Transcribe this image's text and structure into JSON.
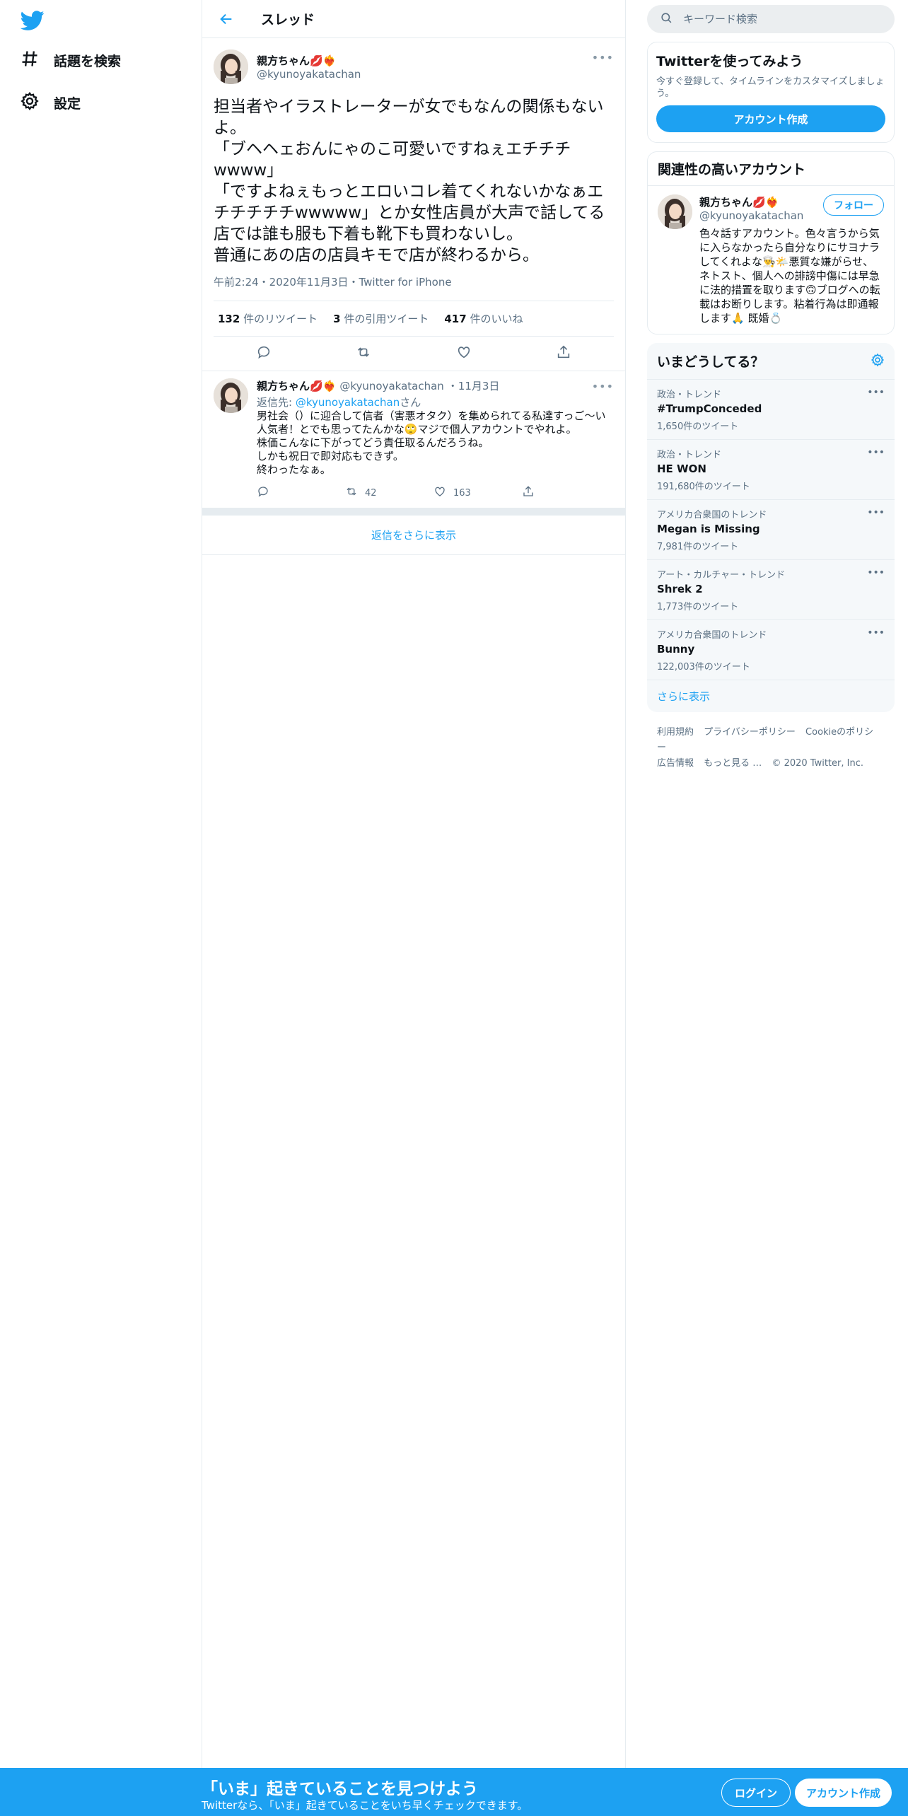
{
  "nav": {
    "explore_label": "話題を検索",
    "settings_label": "設定"
  },
  "thread": {
    "title": "スレッド"
  },
  "main_tweet": {
    "display_name": "親方ちゃん💋❤️‍🔥",
    "handle": "@kyunoyakatachan",
    "text": "担当者やイラストレーターが女でもなんの関係もないよ。\n「ブヘヘェおんにゃのこ可愛いですねぇエチチチwwww」\n「ですよねぇもっとエロいコレ着てくれないかなぁエチチチチチwwwww」とか女性店員が大声で話してる店では誰も服も下着も靴下も買わないし。\n普通にあの店の店員キモで店が終わるから。",
    "meta": "午前2:24・2020年11月3日・Twitter for iPhone",
    "stats": {
      "retweets": "132",
      "retweets_label": "件のリツイート",
      "quotes": "3",
      "quotes_label": "件の引用ツイート",
      "likes": "417",
      "likes_label": "件のいいね"
    }
  },
  "reply": {
    "display_name": "親方ちゃん💋❤️‍🔥",
    "handle": "@kyunoyakatachan",
    "date": "・11月3日",
    "reply_to_prefix": "返信先: ",
    "reply_to_handle": "@kyunoyakatachan",
    "reply_to_suffix": "さん",
    "text": "男社会（）に迎合して信者（害悪オタク）を集められてる私達すっご〜い人気者！とでも思ってたんかな🙄マジで個人アカウントでやれよ。\n株価こんなに下がってどう責任取るんだろうね。\nしかも祝日で即対応もできず。\n終わったなぁ。",
    "retweets": "42",
    "likes": "163"
  },
  "show_more_replies": "返信をさらに表示",
  "search": {
    "placeholder": "キーワード検索"
  },
  "signup_card": {
    "title": "Twitterを使ってみよう",
    "desc": "今すぐ登録して、タイムラインをカスタマイズしましょう。",
    "button": "アカウント作成"
  },
  "related": {
    "title": "関連性の高いアカウント",
    "display_name": "親方ちゃん💋❤️‍🔥",
    "handle": "@kyunoyakatachan",
    "follow": "フォロー",
    "desc": "色々話すアカウント。色々言うから気に入らなかったら自分なりにサヨナラしてくれよな👨‍🍳🌤️悪質な嫌がらせ、ネトスト、個人への誹謗中傷には早急に法的措置を取ります🙃ブログへの転載はお断りします。粘着行為は即通報します🙏 既婚💍"
  },
  "trends": {
    "title": "いまどうしてる？",
    "items": [
      {
        "category": "政治・トレンド",
        "name": "#TrumpConceded",
        "count": "1,650件のツイート"
      },
      {
        "category": "政治・トレンド",
        "name": "HE WON",
        "count": "191,680件のツイート"
      },
      {
        "category": "アメリカ合衆国のトレンド",
        "name": "Megan is Missing",
        "count": "7,981件のツイート"
      },
      {
        "category": "アート・カルチャー・トレンド",
        "name": "Shrek 2",
        "count": "1,773件のツイート"
      },
      {
        "category": "アメリカ合衆国のトレンド",
        "name": "Bunny",
        "count": "122,003件のツイート"
      }
    ],
    "more": "さらに表示"
  },
  "footer": {
    "terms": "利用規約",
    "privacy": "プライバシーポリシー",
    "cookie": "Cookieのポリシー",
    "ads": "広告情報",
    "more": "もっと見る …",
    "copyright": "© 2020 Twitter, Inc."
  },
  "bottom_bar": {
    "title": "「いま」起きていることを見つけよう",
    "subtitle": "Twitterなら、「いま」起きていることをいち早くチェックできます。",
    "login": "ログイン",
    "signup": "アカウント作成"
  },
  "colors": {
    "accent": "#1da1f2",
    "border": "#e6ecf0",
    "muted": "#5b7083"
  }
}
